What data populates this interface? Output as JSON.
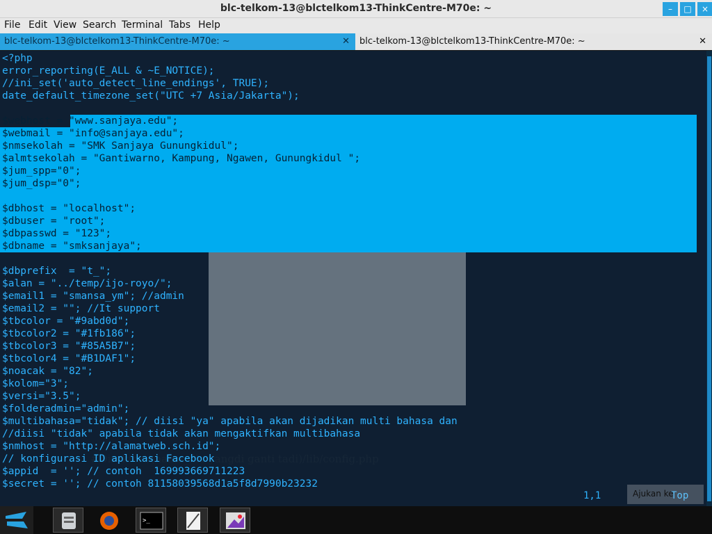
{
  "window": {
    "title": "blc-telkom-13@blctelkom13-ThinkCentre-M70e: ~"
  },
  "menu": [
    "File",
    "Edit",
    "View",
    "Search",
    "Terminal",
    "Tabs",
    "Help"
  ],
  "tabs": [
    {
      "label": "blc-telkom-13@blctelkom13-ThinkCentre-M70e: ~"
    },
    {
      "label": "blc-telkom-13@blctelkom13-ThinkCentre-M70e: ~"
    }
  ],
  "code_lines": [
    "<?php",
    "error_reporting(E_ALL & ~E_NOTICE);",
    "//ini_set('auto_detect_line_endings', TRUE);",
    "date_default_timezone_set(\"UTC +7 Asia/Jakarta\");",
    "",
    "$webhost = \"www.sanjaya.edu\";",
    "$webmail = \"info@sanjaya.edu\";",
    "$nmsekolah = \"SMK Sanjaya Gunungkidul\";",
    "$almtsekolah = \"Gantiwarno, Kampung, Ngawen, Gunungkidul \";",
    "$jum_spp=\"0\";",
    "$jum_dsp=\"0\";",
    "",
    "$dbhost = \"localhost\";",
    "$dbuser = \"root\";",
    "$dbpasswd = \"123\";",
    "$dbname = \"smksanjaya\";",
    "",
    "$dbprefix  = \"t_\";",
    "$alan = \"../temp/ijo-royo/\";",
    "$email1 = \"smansa_ym\"; //admin",
    "$email2 = \"\"; //It support",
    "$tbcolor = \"#9abd0d\";",
    "$tbcolor2 = \"#1fb186\";",
    "$tbcolor3 = \"#85A5B7\";",
    "$tbcolor4 = \"#B1DAF1\";",
    "$noacak = \"82\";",
    "$kolom=\"3\";",
    "$versi=\"3.5\";",
    "$folderadmin=\"admin\";",
    "$multibahasa=\"tidak\"; // diisi \"ya\" apabila akan dijadikan multi bahasa dan",
    "//diisi \"tidak\" apabila tidak akan mengaktifkan multibahasa",
    "$nmhost = \"http://alamatweb.sch.id\";",
    "// konfigurasi ID aplikasi Facebook",
    "$appid  = ''; // contoh  169993669711223",
    "$secret = ''; // contoh 81158039568d1a5f8d7990b23232"
  ],
  "status": {
    "position": "1,1",
    "scroll": "Top"
  },
  "ghost_doc": {
    "line1": "#Direktori/(nama_file yangdi ganti tadi)/lib/config.php",
    "line2": "Ajukan ke"
  },
  "taskbar": {
    "items": [
      "launcher-icon",
      "files-icon",
      "firefox-icon",
      "terminal-icon",
      "editor-icon",
      "image-viewer-icon"
    ]
  },
  "colors": {
    "accent": "#29a3e0",
    "selection": "#00acf0",
    "code": "#2fb3ff"
  }
}
